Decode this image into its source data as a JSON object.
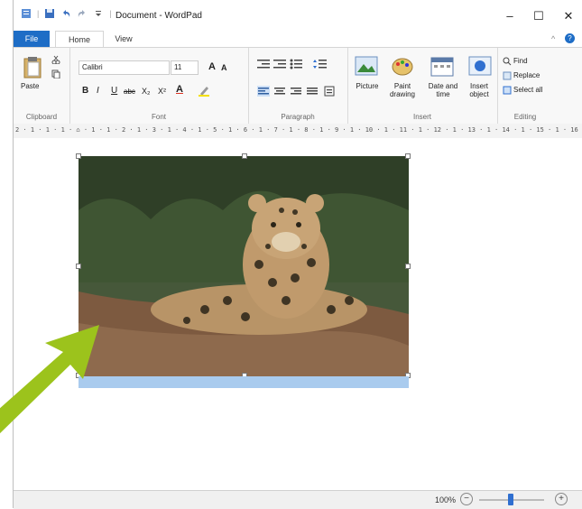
{
  "title_bar": {
    "document_title": "Document - WordPad",
    "minimize": "–",
    "maximize": "☐",
    "close": "✕"
  },
  "tabs": [
    {
      "label": "File"
    },
    {
      "label": "Home"
    },
    {
      "label": "View"
    }
  ],
  "ribbon": {
    "clipboard": {
      "paste": "Paste",
      "group": "Clipboard"
    },
    "font": {
      "family": "Calibri",
      "size": "11",
      "group": "Font",
      "bold": "B",
      "italic": "I",
      "underline": "U",
      "strike": "abc",
      "subscript": "X₂",
      "superscript": "X²",
      "grow": "A",
      "shrink": "A"
    },
    "paragraph": {
      "group": "Paragraph"
    },
    "insert": {
      "picture": "Picture",
      "paint": "Paint drawing",
      "datetime": "Date and time",
      "object": "Insert object",
      "group": "Insert"
    },
    "editing": {
      "find": "Find",
      "replace": "Replace",
      "select_all": "Select all",
      "group": "Editing"
    }
  },
  "ruler": {
    "text": "2 · 1 · 1 · 1 · ⌂ · 1 · 1 · 2 · 1 · 3 · 1 · 4 · 1 · 5 · 1 · 6 · 1 · 7 · 1 · 8 · 1 · 9 · 1 · 10 · 1 · 11 · 1 · 12 · 1 · 13 · 1 · 14 · 1 · 15 · 1 · 16 · 1 · 17"
  },
  "statusbar": {
    "zoom": "100%",
    "minus": "−",
    "plus": "+"
  }
}
